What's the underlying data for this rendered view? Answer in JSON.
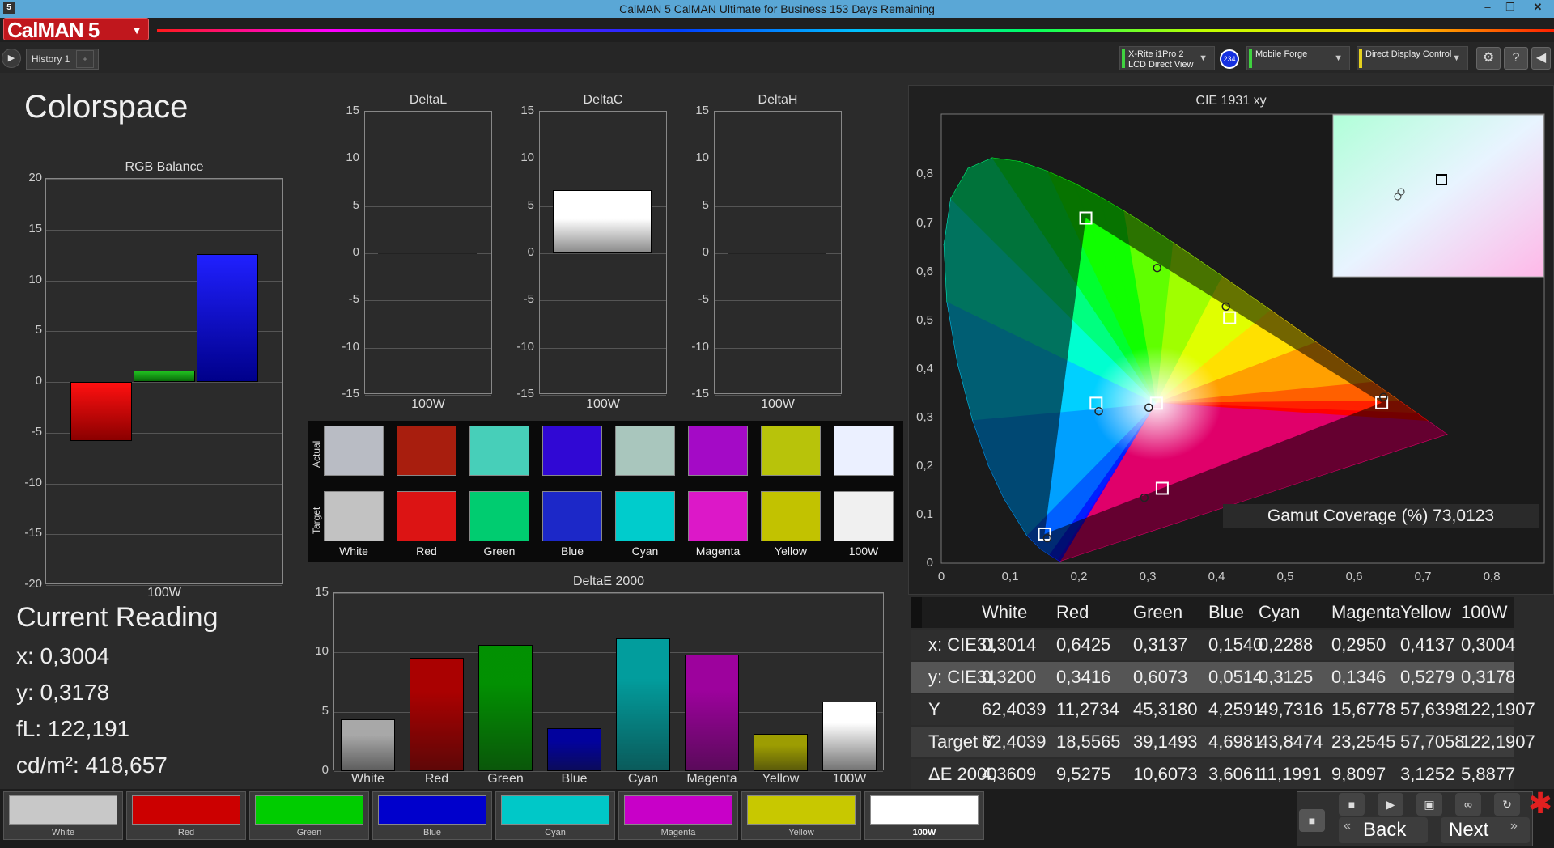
{
  "window": {
    "title": "CalMAN 5 CalMAN Ultimate for Business 153 Days Remaining",
    "app_icon": "5"
  },
  "logo": {
    "text": "CalMAN 5"
  },
  "tabs": {
    "history": "History 1",
    "add": "+"
  },
  "devices": [
    {
      "line1": "X-Rite i1Pro 2",
      "line2": "LCD Direct View",
      "color": "#3fd23f"
    },
    {
      "line1": "Mobile Forge",
      "line2": "",
      "color": "#3fd23f"
    },
    {
      "line1": "Direct Display Control",
      "line2": "",
      "color": "#e6d21e"
    }
  ],
  "badge": "234",
  "page": {
    "heading": "Colorspace"
  },
  "rgb_balance": {
    "title": "RGB Balance",
    "xlabel": "100W",
    "ticks": [
      "20",
      "15",
      "10",
      "5",
      "0",
      "-5",
      "-10",
      "-15",
      "-20"
    ],
    "chart_data": {
      "type": "bar",
      "categories": [
        "Red",
        "Green",
        "Blue"
      ],
      "values": [
        -5.8,
        1.1,
        12.6
      ],
      "ylim": [
        -20,
        20
      ]
    }
  },
  "delta_charts": [
    {
      "title": "DeltaL",
      "xlabel": "100W",
      "value": 0.0
    },
    {
      "title": "DeltaC",
      "xlabel": "100W",
      "value": 6.7
    },
    {
      "title": "DeltaH",
      "xlabel": "100W",
      "value": 0.0
    }
  ],
  "delta_ticks": [
    "15",
    "10",
    "5",
    "0",
    "-5",
    "-10",
    "-15"
  ],
  "swatches": {
    "actual_label": "Actual",
    "target_label": "Target",
    "items": [
      {
        "label": "White",
        "actual": "#b9bcc4",
        "target": "#c2c2c2"
      },
      {
        "label": "Red",
        "actual": "#a81e0e",
        "target": "#dc1414"
      },
      {
        "label": "Green",
        "actual": "#47cfb9",
        "target": "#00cc70"
      },
      {
        "label": "Blue",
        "actual": "#3008d4",
        "target": "#1c28c8"
      },
      {
        "label": "Cyan",
        "actual": "#a9c6bd",
        "target": "#00cccc"
      },
      {
        "label": "Magenta",
        "actual": "#a40ac6",
        "target": "#dc18c8"
      },
      {
        "label": "Yellow",
        "actual": "#b8c30a",
        "target": "#c2c200"
      },
      {
        "label": "100W",
        "actual": "#ebf0ff",
        "target": "#f0f0f0"
      }
    ]
  },
  "deltae_chart": {
    "title": "DeltaE 2000",
    "ticks": [
      "15",
      "10",
      "5",
      "0"
    ],
    "chart_data": {
      "type": "bar",
      "categories": [
        "White",
        "Red",
        "Green",
        "Blue",
        "Cyan",
        "Magenta",
        "Yellow",
        "100W"
      ],
      "values": [
        4.3609,
        9.5275,
        10.6073,
        3.6061,
        11.1991,
        9.8097,
        3.1252,
        5.8877
      ],
      "colors": [
        "#cfcfcf",
        "#d01010",
        "#16c016",
        "#1818c8",
        "#16c8c8",
        "#c816c8",
        "#c8c816",
        "#ffffff"
      ],
      "ylim": [
        0,
        15
      ]
    }
  },
  "current_reading": {
    "title": "Current Reading",
    "x": "x: 0,3004",
    "y": "y: 0,3178",
    "fl": "fL: 122,191",
    "cdm": "cd/m²: 418,657"
  },
  "cie": {
    "title": "CIE 1931 xy",
    "yticks": [
      "0,8",
      "0,7",
      "0,6",
      "0,5",
      "0,4",
      "0,3",
      "0,2",
      "0,1",
      "0"
    ],
    "xticks": [
      "0",
      "0,1",
      "0,2",
      "0,3",
      "0,4",
      "0,5",
      "0,6",
      "0,7",
      "0,8"
    ],
    "gamut_coverage": "Gamut Coverage (%) 73,0123",
    "chart_data": {
      "type": "scatter",
      "targets": [
        [
          0.21,
          0.71
        ],
        [
          0.64,
          0.33
        ],
        [
          0.15,
          0.06
        ],
        [
          0.225,
          0.329
        ],
        [
          0.321,
          0.154
        ],
        [
          0.419,
          0.505
        ],
        [
          0.3127,
          0.329
        ]
      ],
      "measured": [
        [
          0.3137,
          0.6073
        ],
        [
          0.6425,
          0.3416
        ],
        [
          0.154,
          0.0514
        ],
        [
          0.2288,
          0.3125
        ],
        [
          0.295,
          0.1346
        ],
        [
          0.4137,
          0.5279
        ],
        [
          0.3014,
          0.32
        ]
      ],
      "xlim": [
        0,
        0.85
      ],
      "ylim": [
        0,
        0.85
      ]
    }
  },
  "table": {
    "headers": [
      "",
      "White",
      "Red",
      "Green",
      "Blue",
      "Cyan",
      "Magenta",
      "Yellow",
      "100W"
    ],
    "rows": [
      [
        "x: CIE31",
        "0,3014",
        "0,6425",
        "0,3137",
        "0,1540",
        "0,2288",
        "0,2950",
        "0,4137",
        "0,3004"
      ],
      [
        "y: CIE31",
        "0,3200",
        "0,3416",
        "0,6073",
        "0,0514",
        "0,3125",
        "0,1346",
        "0,5279",
        "0,3178"
      ],
      [
        "Y",
        "62,4039",
        "11,2734",
        "45,3180",
        "4,2591",
        "49,7316",
        "15,6778",
        "57,6398",
        "122,1907"
      ],
      [
        "Target Y",
        "62,4039",
        "18,5565",
        "39,1493",
        "4,6981",
        "43,8474",
        "23,2545",
        "57,7058",
        "122,1907"
      ],
      [
        "ΔE 2000",
        "4,3609",
        "9,5275",
        "10,6073",
        "3,6061",
        "11,1991",
        "9,8097",
        "3,1252",
        "5,8877"
      ]
    ]
  },
  "bottom": {
    "swatches": [
      {
        "label": "White",
        "color": "#c8c8c8"
      },
      {
        "label": "Red",
        "color": "#cc0000"
      },
      {
        "label": "Green",
        "color": "#00cc00"
      },
      {
        "label": "Blue",
        "color": "#0000cc"
      },
      {
        "label": "Cyan",
        "color": "#00c8c8"
      },
      {
        "label": "Magenta",
        "color": "#c800c8"
      },
      {
        "label": "Yellow",
        "color": "#c8c800"
      },
      {
        "label": "100W",
        "color": "#ffffff"
      }
    ],
    "back": "Back",
    "next": "Next"
  }
}
